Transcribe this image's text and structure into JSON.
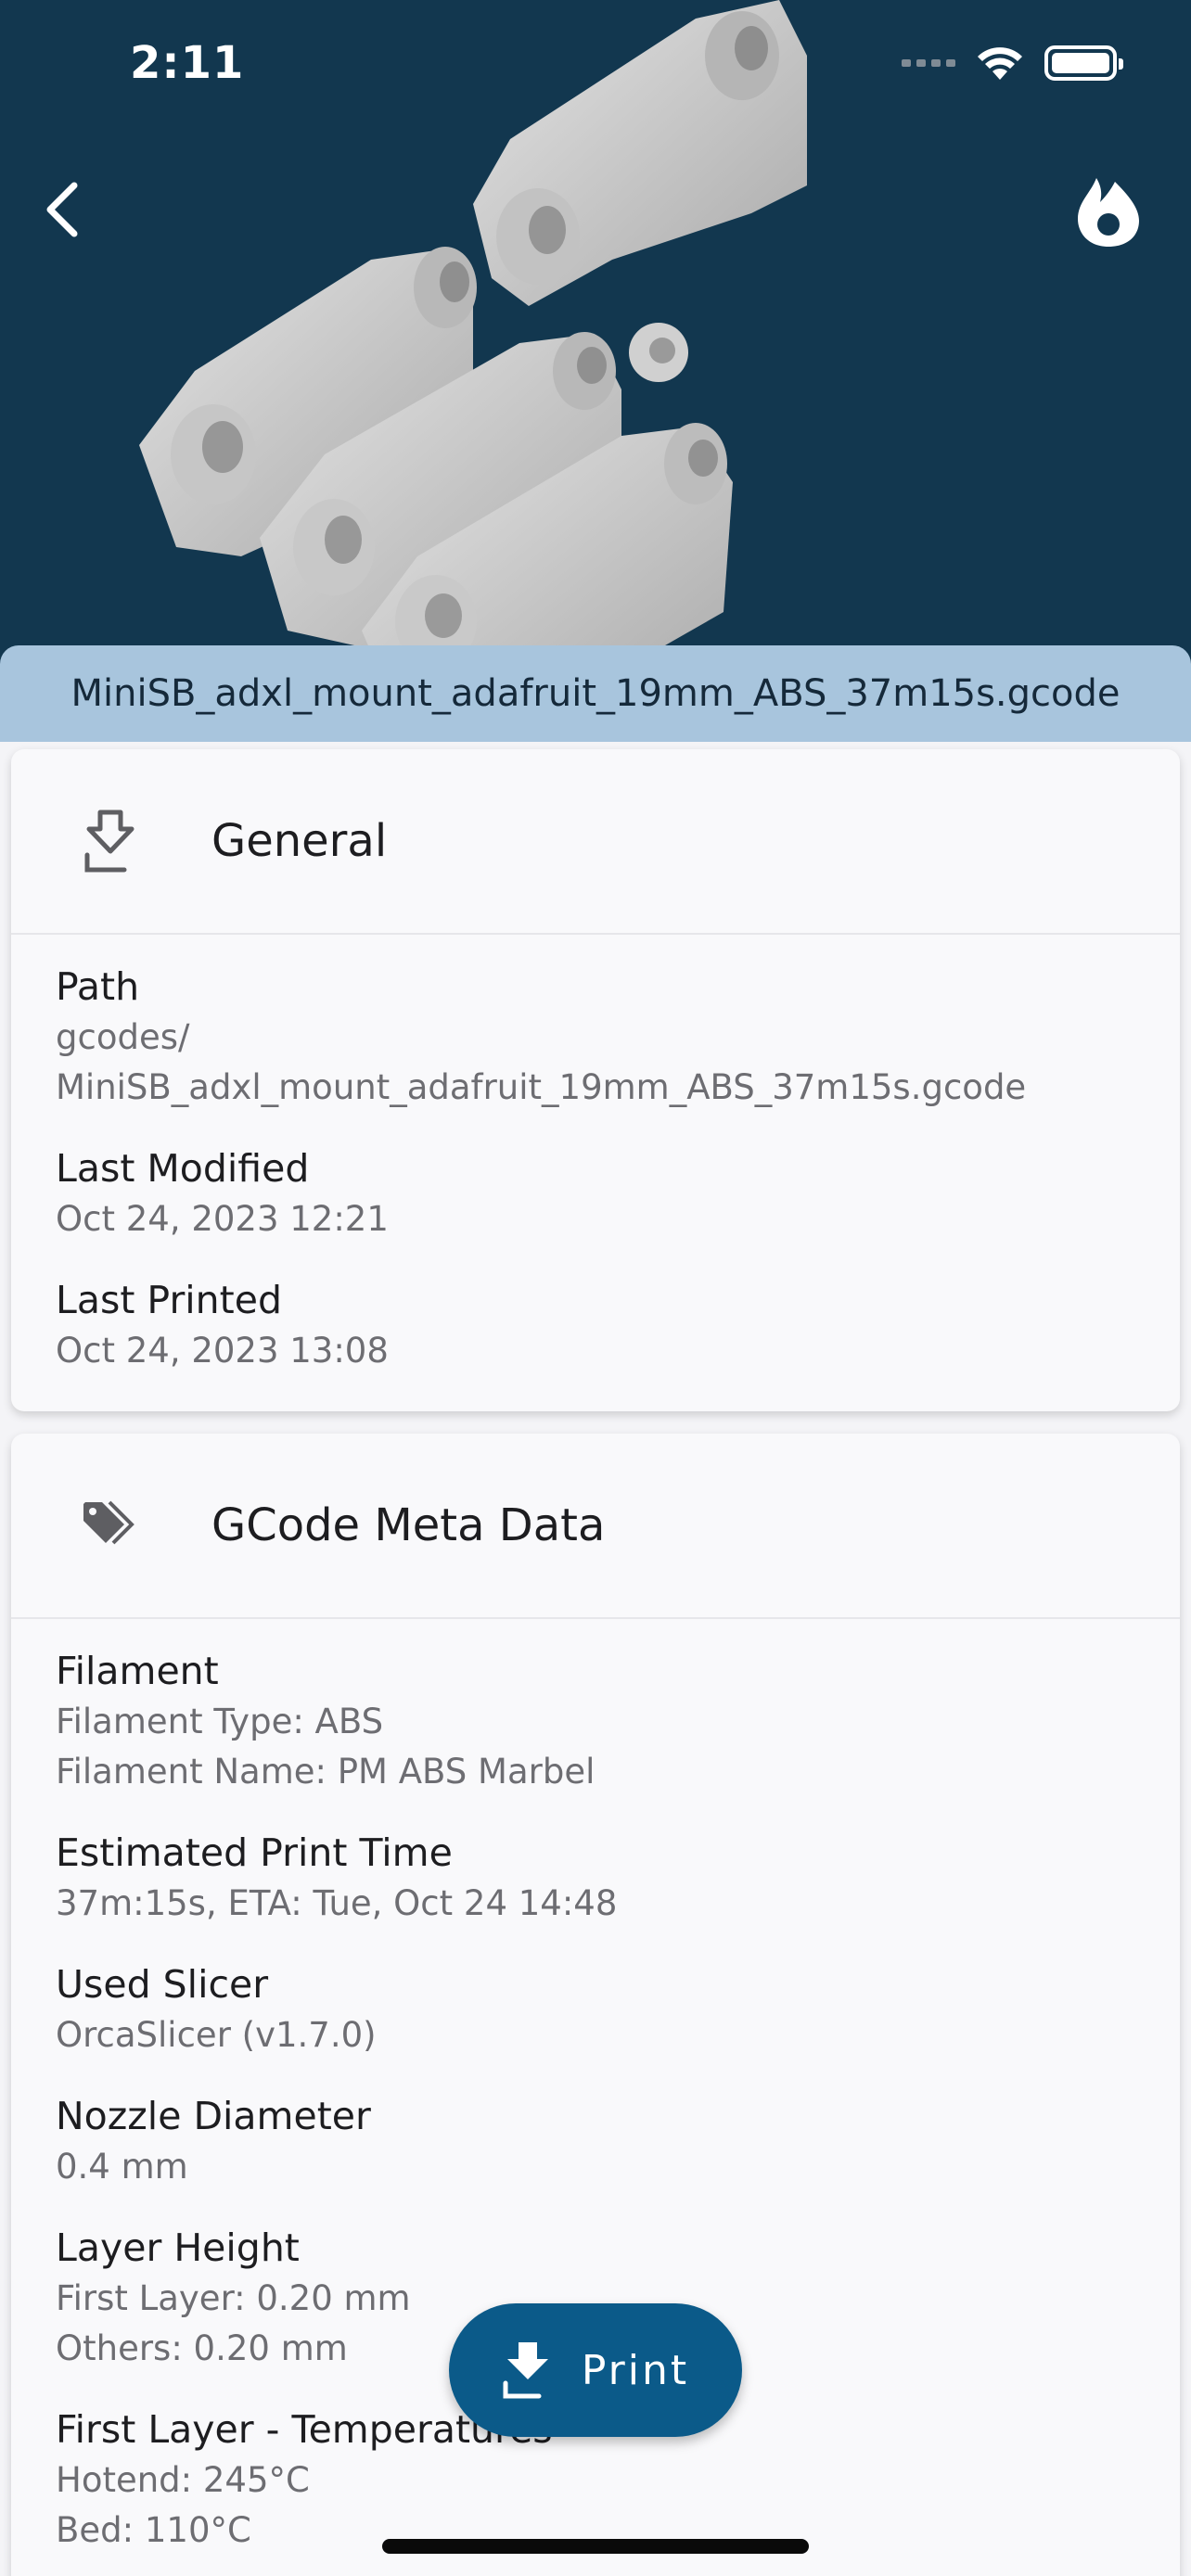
{
  "status_bar": {
    "time": "2:11"
  },
  "header": {
    "file_name": "MiniSB_adxl_mount_adafruit_19mm_ABS_37m15s.gcode",
    "back_icon": "chevron-left-icon",
    "action_icon": "flame-icon"
  },
  "general": {
    "title": "General",
    "icon": "file-download-icon",
    "fields": [
      {
        "label": "Path",
        "value": "gcodes/",
        "value2": "MiniSB_adxl_mount_adafruit_19mm_ABS_37m15s.gcode"
      },
      {
        "label": "Last Modified",
        "value": "Oct 24, 2023 12:21"
      },
      {
        "label": "Last Printed",
        "value": "Oct 24, 2023 13:08"
      }
    ]
  },
  "meta": {
    "title": "GCode Meta Data",
    "icon": "tags-icon",
    "fields": [
      {
        "label": "Filament",
        "value": "Filament Type: ABS",
        "value2": "Filament Name: PM ABS Marbel"
      },
      {
        "label": "Estimated Print Time",
        "value": "37m:15s, ETA: Tue, Oct 24 14:48"
      },
      {
        "label": "Used Slicer",
        "value": "OrcaSlicer (v1.7.0)"
      },
      {
        "label": "Nozzle Diameter",
        "value": "0.4 mm"
      },
      {
        "label": "Layer Height",
        "value": "First Layer: 0.20 mm",
        "value2": "Others: 0.20 mm"
      },
      {
        "label": "First Layer - Temperatures",
        "value": "Hotend: 245°C",
        "value2": "Bed: 110°C"
      }
    ]
  },
  "fab": {
    "label": "Print",
    "icon": "print-download-icon"
  },
  "colors": {
    "header_bg": "#12374f",
    "strip": "#a8c5dd",
    "accent": "#0b5a89"
  }
}
